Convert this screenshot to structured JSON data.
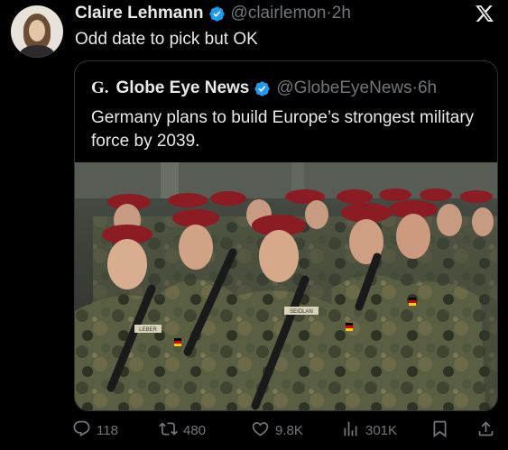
{
  "tweet": {
    "author_name": "Claire Lehmann",
    "author_handle": "@clairlemon",
    "separator": "·",
    "time": "2h",
    "text": "Odd date to pick but OK"
  },
  "quoted": {
    "logo_text": "G.",
    "author_name": "Globe Eye News",
    "author_handle": "@GlobeEyeNews",
    "separator": "·",
    "time": "6h",
    "text": "Germany plans to build Europe’s strongest military force by 2039.",
    "name_tags": [
      "LEBER",
      "SEIDLAN"
    ]
  },
  "actions": {
    "replies": "118",
    "reposts": "480",
    "likes": "9.8K",
    "views": "301K"
  },
  "icons": {
    "verified": "verified-badge-icon",
    "platform": "x-logo-icon",
    "reply": "reply-icon",
    "repost": "repost-icon",
    "like": "heart-icon",
    "views": "views-icon",
    "bookmark": "bookmark-icon",
    "share": "share-icon"
  },
  "colors": {
    "background": "#000000",
    "text": "#e7e9ea",
    "muted": "#71767b",
    "verified": "#1d9bf0",
    "border": "#2f3336",
    "beret": "#8c1c24"
  }
}
